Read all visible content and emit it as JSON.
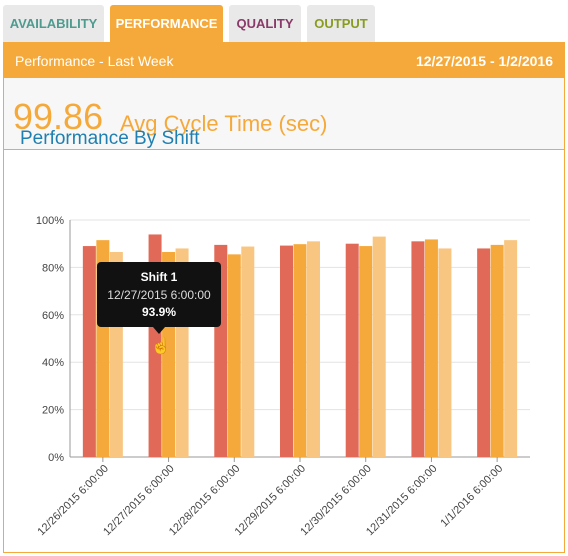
{
  "tabs": {
    "availability": "AVAILABILITY",
    "performance": "PERFORMANCE",
    "quality": "QUALITY",
    "output": "OUTPUT",
    "active": "PERFORMANCE"
  },
  "panel": {
    "title": "Performance - Last Week",
    "date_range": "12/27/2015 - 1/2/2016"
  },
  "kpi": {
    "value": "99.86",
    "label": "Avg Cycle Time (sec)"
  },
  "chart": {
    "title": "Performance By Shift"
  },
  "tooltip": {
    "series": "Shift 1",
    "date": "12/27/2015 6:00:00",
    "value": "93.9%"
  },
  "colors": {
    "accent": "#f5a93a",
    "shift1": "#e06a57",
    "shift2": "#f5a93a",
    "shift3": "#f8c680",
    "title_blue": "#1f7fb0"
  },
  "chart_data": {
    "type": "bar",
    "categories": [
      "12/26/2015 6:00:00",
      "12/27/2015 6:00:00",
      "12/28/2015 6:00:00",
      "12/29/2015 6:00:00",
      "12/30/2015 6:00:00",
      "12/31/2015 6:00:00",
      "1/1/2016 6:00:00"
    ],
    "series": [
      {
        "values": [
          89.0,
          93.9,
          89.5,
          89.2,
          90.0,
          91.0,
          88.0
        ]
      },
      {
        "values": [
          91.5,
          86.5,
          85.5,
          89.8,
          89.0,
          91.8,
          89.5
        ]
      },
      {
        "values": [
          86.5,
          88.0,
          88.8,
          91.0,
          93.0,
          88.0,
          91.5
        ]
      }
    ],
    "yticks": [
      "0%",
      "20%",
      "40%",
      "60%",
      "80%",
      "100%"
    ],
    "ylim": [
      0,
      100
    ],
    "grid": true
  }
}
